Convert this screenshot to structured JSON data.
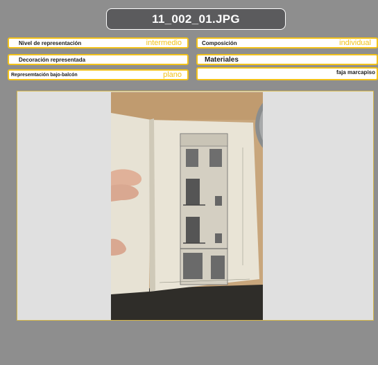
{
  "header": {
    "title": "11_002_01.JPG"
  },
  "fields": {
    "nivel": {
      "label": "Nivel de representación",
      "value": "intermedio"
    },
    "composicion": {
      "label": "Composición",
      "value": "individual"
    },
    "decoracion": {
      "label": "Decoración representada"
    },
    "materiales": {
      "label": "Materiales"
    },
    "representacion_balcon": {
      "label": "Represemtación bajo-balcón",
      "value": "plano"
    },
    "faja": {
      "value": "faja marcapiso"
    }
  },
  "colors": {
    "background": "#8e8e8e",
    "title_bg": "#5b5b5d",
    "accent_yellow": "#f2c21b",
    "viewer_bg": "#e0e0e0"
  },
  "image": {
    "semantic": "photo-of-architectural-facade-drawing"
  }
}
